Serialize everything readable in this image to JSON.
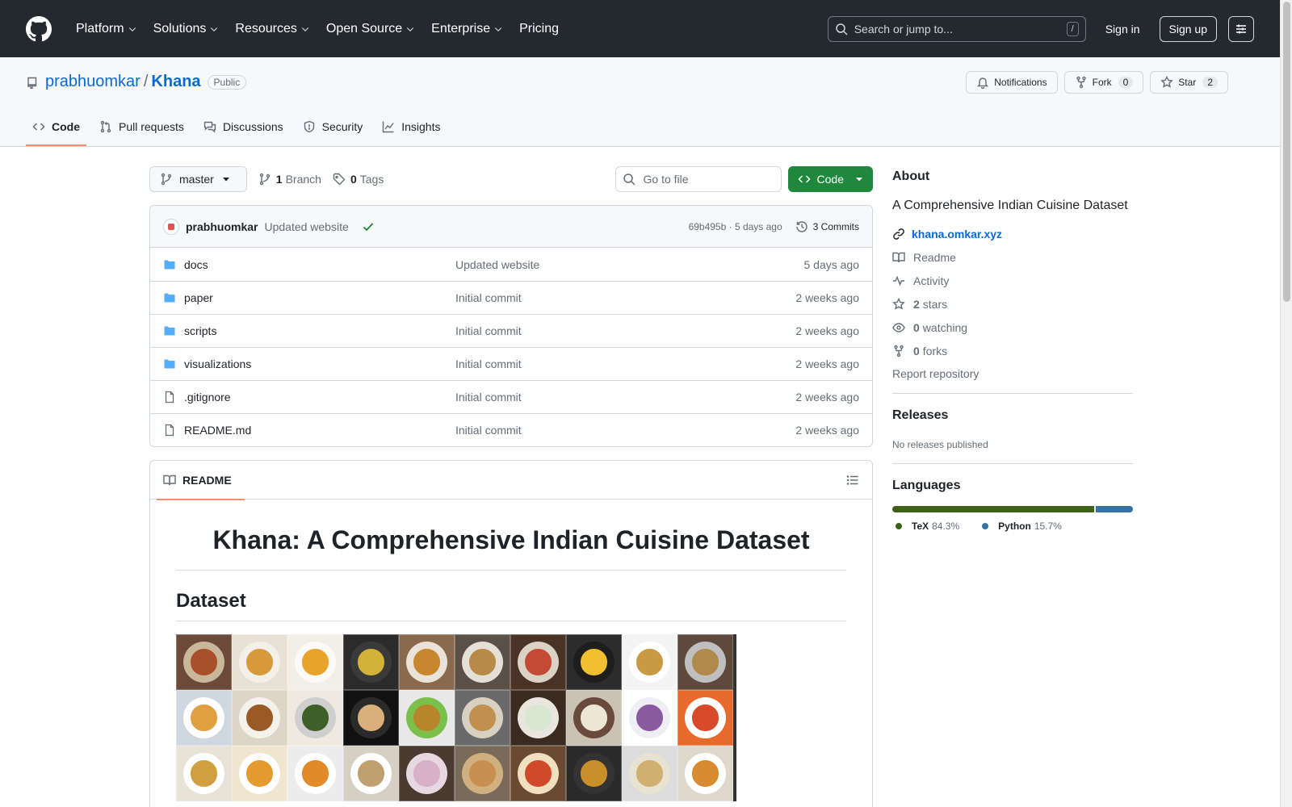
{
  "header": {
    "nav": [
      "Platform",
      "Solutions",
      "Resources",
      "Open Source",
      "Enterprise",
      "Pricing"
    ],
    "search_placeholder": "Search or jump to...",
    "search_kbd": "/",
    "sign_in": "Sign in",
    "sign_up": "Sign up"
  },
  "repo": {
    "owner": "prabhuomkar",
    "separator": "/",
    "name": "Khana",
    "visibility": "Public",
    "notifications_label": "Notifications",
    "fork_label": "Fork",
    "fork_count": "0",
    "star_label": "Star",
    "star_count": "2",
    "tabs": [
      "Code",
      "Pull requests",
      "Discussions",
      "Security",
      "Insights"
    ]
  },
  "toolbar": {
    "branch": "master",
    "branch_count": "1",
    "branch_label": "Branch",
    "tag_count": "0",
    "tag_label": "Tags",
    "goto_placeholder": "Go to file",
    "code_button": "Code"
  },
  "commit": {
    "author": "prabhuomkar",
    "message": "Updated website",
    "hash_time": "69b495b · 5 days ago",
    "commits": "3 Commits"
  },
  "files": [
    {
      "name": "docs",
      "type": "folder",
      "message": "Updated website",
      "date": "5 days ago"
    },
    {
      "name": "paper",
      "type": "folder",
      "message": "Initial commit",
      "date": "2 weeks ago"
    },
    {
      "name": "scripts",
      "type": "folder",
      "message": "Initial commit",
      "date": "2 weeks ago"
    },
    {
      "name": "visualizations",
      "type": "folder",
      "message": "Initial commit",
      "date": "2 weeks ago"
    },
    {
      "name": ".gitignore",
      "type": "file",
      "message": "Initial commit",
      "date": "2 weeks ago"
    },
    {
      "name": "README.md",
      "type": "file",
      "message": "Initial commit",
      "date": "2 weeks ago"
    }
  ],
  "readme": {
    "tab_label": "README",
    "h1": "Khana: A Comprehensive Indian Cuisine Dataset",
    "h2": "Dataset"
  },
  "sidebar": {
    "about_title": "About",
    "description": "A Comprehensive Indian Cuisine Dataset",
    "website": "khana.omkar.xyz",
    "readme": "Readme",
    "activity": "Activity",
    "stars_count": "2",
    "stars_label": "stars",
    "watching_count": "0",
    "watching_label": "watching",
    "forks_count": "0",
    "forks_label": "forks",
    "report": "Report repository",
    "releases_title": "Releases",
    "releases_empty": "No releases published",
    "languages_title": "Languages",
    "languages": [
      {
        "name": "TeX",
        "percent": "84.3%",
        "value": 84.3,
        "color": "#3D6117"
      },
      {
        "name": "Python",
        "percent": "15.7%",
        "value": 15.7,
        "color": "#3572A5"
      }
    ]
  },
  "colors": {
    "header_bg": "#24292f",
    "accent_link": "#0969da",
    "code_button": "#1f883d",
    "tab_underline": "#fd8c73"
  }
}
